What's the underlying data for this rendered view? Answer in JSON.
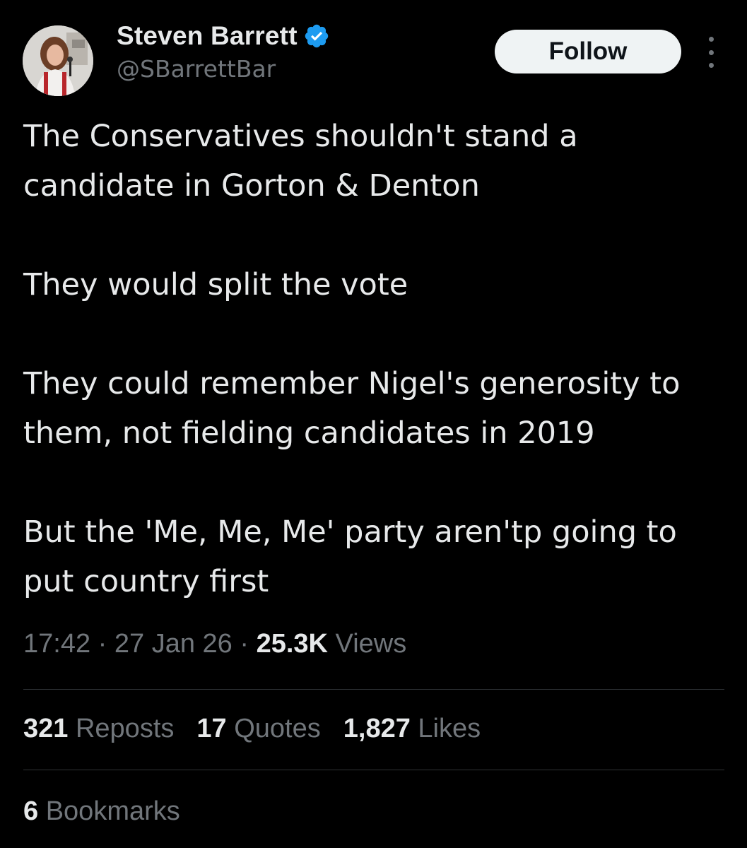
{
  "author": {
    "display_name": "Steven Barrett",
    "handle": "@SBarrettBar",
    "verified": true,
    "verified_color": "#1d9bf0"
  },
  "actions": {
    "follow_label": "Follow",
    "more_icon": "more-vertical-icon"
  },
  "tweet": {
    "paragraphs": [
      "The Conservatives shouldn't stand a candidate in Gorton & Denton",
      "They would split the vote",
      "They could remember Nigel's generosity to them, not fielding candidates in 2019",
      "But the 'Me, Me, Me' party aren'tp going to put country first"
    ]
  },
  "meta": {
    "time": "17:42",
    "date": "27 Jan 26",
    "separator": "·",
    "views_count": "25.3K",
    "views_label": "Views"
  },
  "stats": {
    "reposts_count": "321",
    "reposts_label": "Reposts",
    "quotes_count": "17",
    "quotes_label": "Quotes",
    "likes_count": "1,827",
    "likes_label": "Likes",
    "bookmarks_count": "6",
    "bookmarks_label": "Bookmarks"
  },
  "colors": {
    "background": "#000000",
    "text_primary": "#e7e9ea",
    "text_secondary": "#71767b",
    "divider": "#2f3336",
    "follow_bg": "#eff3f4"
  }
}
